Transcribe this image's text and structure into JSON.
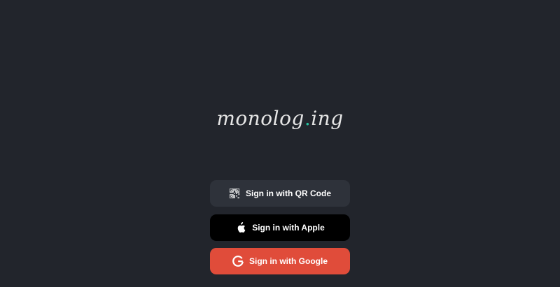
{
  "brand": {
    "name_part1": "monolog",
    "dot": ".",
    "name_part2": "ing"
  },
  "buttons": {
    "qr_label": "Sign in with QR Code",
    "apple_label": "Sign in with Apple",
    "google_label": "Sign in with Google"
  },
  "colors": {
    "background": "#22252c",
    "accent_dot": "#25c3a0",
    "qr_button": "#2e323a",
    "apple_button": "#000000",
    "google_button": "#e04c3a"
  },
  "icons": {
    "qr": "qr-code-icon",
    "apple": "apple-icon",
    "google": "google-icon"
  }
}
